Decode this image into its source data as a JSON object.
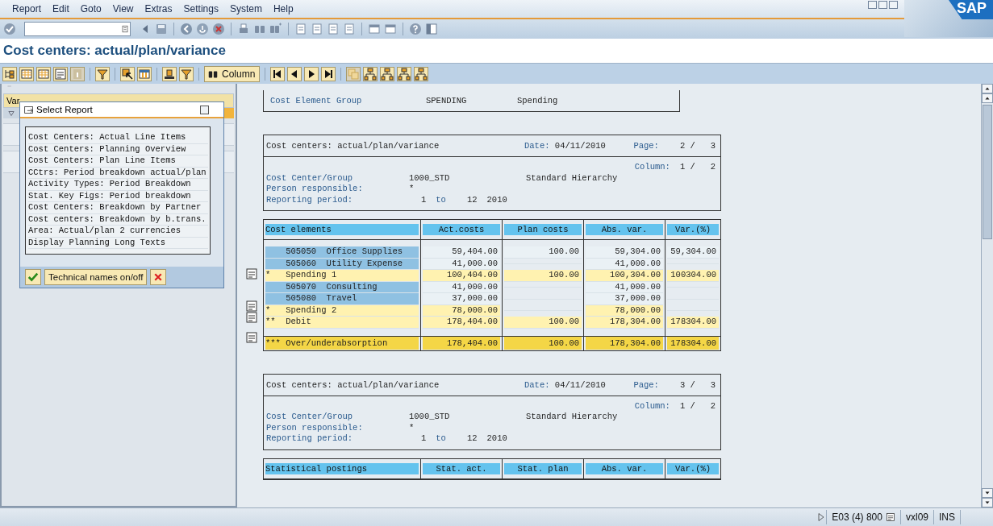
{
  "menu": [
    "Report",
    "Edit",
    "Goto",
    "View",
    "Extras",
    "Settings",
    "System",
    "Help"
  ],
  "logo": "SAP",
  "title": "Cost centers: actual/plan/variance",
  "app_toolbar": {
    "column_button": "Column"
  },
  "left_pane": {
    "header": "Var"
  },
  "dialog": {
    "title": "Select Report",
    "items": [
      "Cost Centers: Actual Line Items",
      "Cost Centers: Planning Overview",
      "Cost Centers: Plan Line Items",
      "CCtrs: Period breakdown actual/plan",
      "Activity Types: Period Breakdown",
      "Stat. Key Figs: Period breakdown",
      "Cost Centers: Breakdown by Partner",
      "Cost centers: Breakdown by b.trans.",
      "Area: Actual/plan 2 currencies",
      "Display Planning Long Texts"
    ],
    "technical_names_button": "Technical names on/off"
  },
  "report": {
    "group": {
      "label": "Cost Element Group",
      "code": "SPENDING",
      "name": "Spending"
    },
    "pages": [
      {
        "title": "Cost centers: actual/plan/variance",
        "date_label": "Date:",
        "date": "04/11/2010",
        "page_label": "Page:",
        "page": "2 /   3",
        "column_label": "Column:",
        "column": "1 /   2",
        "cost_center_label": "Cost Center/Group",
        "cost_center": "1000_STD",
        "hierarchy": "Standard Hierarchy",
        "person_label": "Person responsible:",
        "person": "*",
        "period_label": "Reporting period:",
        "period_from": "1",
        "period_to_word": "to",
        "period_to": "12",
        "period_year": "2010",
        "table": {
          "columns": [
            "Cost elements",
            "Act.costs",
            "Plan costs",
            "Abs. var.",
            "Var.(%)"
          ],
          "rows": [
            {
              "kind": "item",
              "name": "505050  Office Supplies",
              "act_costs": "59,404.00",
              "plan_costs": "100.00",
              "abs_var": "59,304.00",
              "var_pct": "59,304.00"
            },
            {
              "kind": "item",
              "name": "505060  Utility Expense",
              "act_costs": "41,000.00",
              "abs_var": "41,000.00"
            },
            {
              "kind": "subtotal",
              "marker": "*",
              "name": "Spending 1",
              "act_costs": "100,404.00",
              "plan_costs": "100.00",
              "abs_var": "100,304.00",
              "var_pct": "100304.00"
            },
            {
              "kind": "item",
              "name": "505070  Consulting",
              "act_costs": "41,000.00",
              "abs_var": "41,000.00"
            },
            {
              "kind": "item",
              "name": "505080  Travel",
              "act_costs": "37,000.00",
              "abs_var": "37,000.00"
            },
            {
              "kind": "subtotal",
              "marker": "*",
              "name": "Spending 2",
              "act_costs": "78,000.00",
              "abs_var": "78,000.00"
            },
            {
              "kind": "subtotal",
              "marker": "**",
              "name": "Debit",
              "act_costs": "178,404.00",
              "plan_costs": "100.00",
              "abs_var": "178,304.00",
              "var_pct": "178304.00"
            },
            {
              "kind": "total",
              "marker": "***",
              "name": "Over/underabsorption",
              "act_costs": "178,404.00",
              "plan_costs": "100.00",
              "abs_var": "178,304.00",
              "var_pct": "178304.00"
            }
          ]
        }
      },
      {
        "title": "Cost centers: actual/plan/variance",
        "date_label": "Date:",
        "date": "04/11/2010",
        "page_label": "Page:",
        "page": "3 /   3",
        "column_label": "Column:",
        "column": "1 /   2",
        "cost_center_label": "Cost Center/Group",
        "cost_center": "1000_STD",
        "hierarchy": "Standard Hierarchy",
        "person_label": "Person responsible:",
        "person": "*",
        "period_label": "Reporting period:",
        "period_from": "1",
        "period_to_word": "to",
        "period_to": "12",
        "period_year": "2010",
        "table": {
          "columns": [
            "Statistical postings",
            "Stat. act.",
            "Stat. plan",
            "Abs. var.",
            "Var.(%)"
          ]
        }
      }
    ]
  },
  "status_bar": {
    "system": "E03 (4) 800",
    "server": "vxl09",
    "mode": "INS"
  }
}
